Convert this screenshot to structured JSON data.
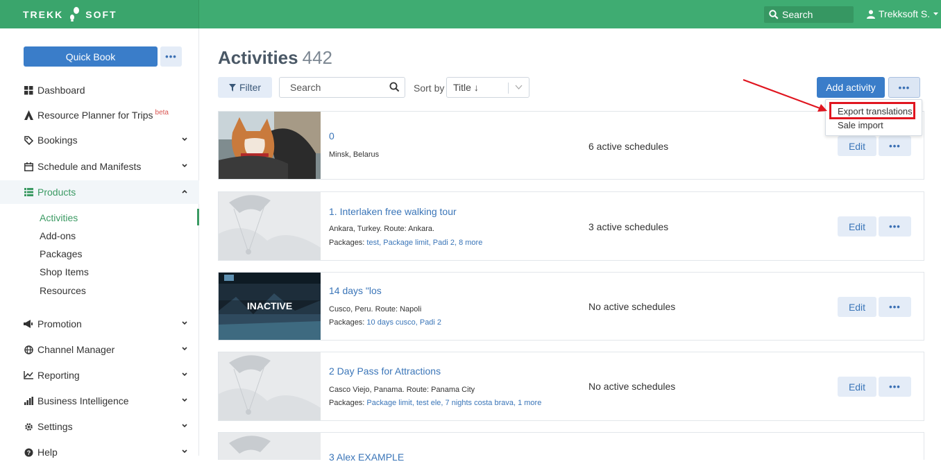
{
  "topbar": {
    "logo_left": "TREKK",
    "logo_right": "SOFT",
    "search_label": "Search",
    "user_label": "Trekksoft S."
  },
  "sidebar": {
    "quick_book": "Quick Book",
    "more": "•••",
    "items": [
      {
        "label": "Dashboard",
        "icon": "grid-icon"
      },
      {
        "label": "Resource Planner for Trips",
        "badge": "beta",
        "icon": "planner-icon"
      },
      {
        "label": "Bookings",
        "icon": "tag-icon"
      },
      {
        "label": "Schedule and Manifests",
        "icon": "calendar-icon"
      },
      {
        "label": "Products",
        "icon": "list-icon"
      },
      {
        "label": "Promotion",
        "icon": "megaphone-icon"
      },
      {
        "label": "Channel Manager",
        "icon": "globe-icon"
      },
      {
        "label": "Reporting",
        "icon": "chart-line-icon"
      },
      {
        "label": "Business Intelligence",
        "icon": "bar-chart-icon"
      },
      {
        "label": "Settings",
        "icon": "gear-icon"
      },
      {
        "label": "Help",
        "icon": "help-icon"
      }
    ],
    "sub_items": [
      "Activities",
      "Add-ons",
      "Packages",
      "Shop Items",
      "Resources"
    ]
  },
  "page": {
    "title": "Activities",
    "count": "442",
    "filter_label": "Filter",
    "search_placeholder": "Search",
    "sort_label": "Sort by",
    "sort_value": "Title ↓",
    "add_label": "Add activity",
    "more": "•••"
  },
  "menu": {
    "items": [
      "Export translations",
      "Sale import"
    ]
  },
  "activities": [
    {
      "title": "0",
      "location": "Minsk, Belarus",
      "packages_prefix": "",
      "packages": "",
      "schedules": "6 active schedules",
      "edit": "Edit",
      "more": "•••"
    },
    {
      "title": "1. Interlaken free walking tour",
      "location": "Ankara, Turkey. Route: Ankara.",
      "packages_prefix": "Packages: ",
      "packages": "test, Package limit, Padi 2, 8 more",
      "schedules": "3 active schedules",
      "edit": "Edit",
      "more": "•••"
    },
    {
      "title": "14 days \"los",
      "location": "Cusco, Peru. Route: Napoli",
      "packages_prefix": "Packages: ",
      "packages": "10 days cusco, Padi 2",
      "schedules": "No active schedules",
      "edit": "Edit",
      "more": "•••",
      "badge": "INACTIVE"
    },
    {
      "title": "2 Day Pass for Attractions",
      "location": "Casco Viejo, Panama. Route: Panama City",
      "packages_prefix": "Packages: ",
      "packages": "Package limit, test ele, 7 nights costa brava, 1 more",
      "schedules": "No active schedules",
      "edit": "Edit",
      "more": "•••"
    },
    {
      "title": "3 Alex EXAMPLE"
    }
  ],
  "colors": {
    "brand_green": "#3fac72",
    "primary_blue": "#3a7dc9",
    "highlight_red": "#e0151f"
  }
}
